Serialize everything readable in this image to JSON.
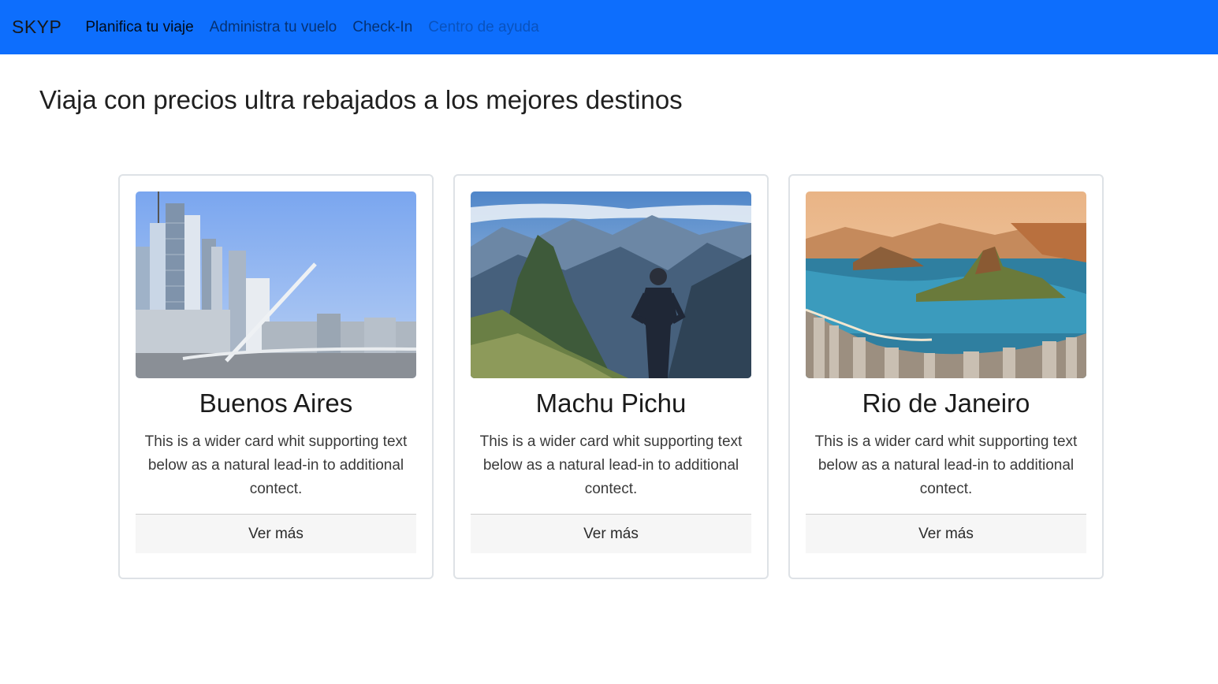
{
  "navbar": {
    "brand": "SKYP",
    "links": [
      {
        "label": "Planifica tu viaje",
        "state": "active"
      },
      {
        "label": "Administra tu vuelo",
        "state": "normal"
      },
      {
        "label": "Check-In",
        "state": "normal"
      },
      {
        "label": "Centro de ayuda",
        "state": "disabled"
      }
    ],
    "color": "#0d6efd"
  },
  "main": {
    "title": "Viaja con precios ultra rebajados a los mejores destinos"
  },
  "cards": [
    {
      "title": "Buenos Aires",
      "text": "This is a wider card whit supporting text below as a natural lead-in to additional contect.",
      "button": "Ver más",
      "image": "buenos-aires-skyline-bridge"
    },
    {
      "title": "Machu Pichu",
      "text": "This is a wider card whit supporting text below as a natural lead-in to additional contect.",
      "button": "Ver más",
      "image": "machu-picchu-hiker"
    },
    {
      "title": "Rio de Janeiro",
      "text": "This is a wider card whit supporting text below as a natural lead-in to additional contect.",
      "button": "Ver más",
      "image": "rio-bay-sugarloaf"
    }
  ]
}
